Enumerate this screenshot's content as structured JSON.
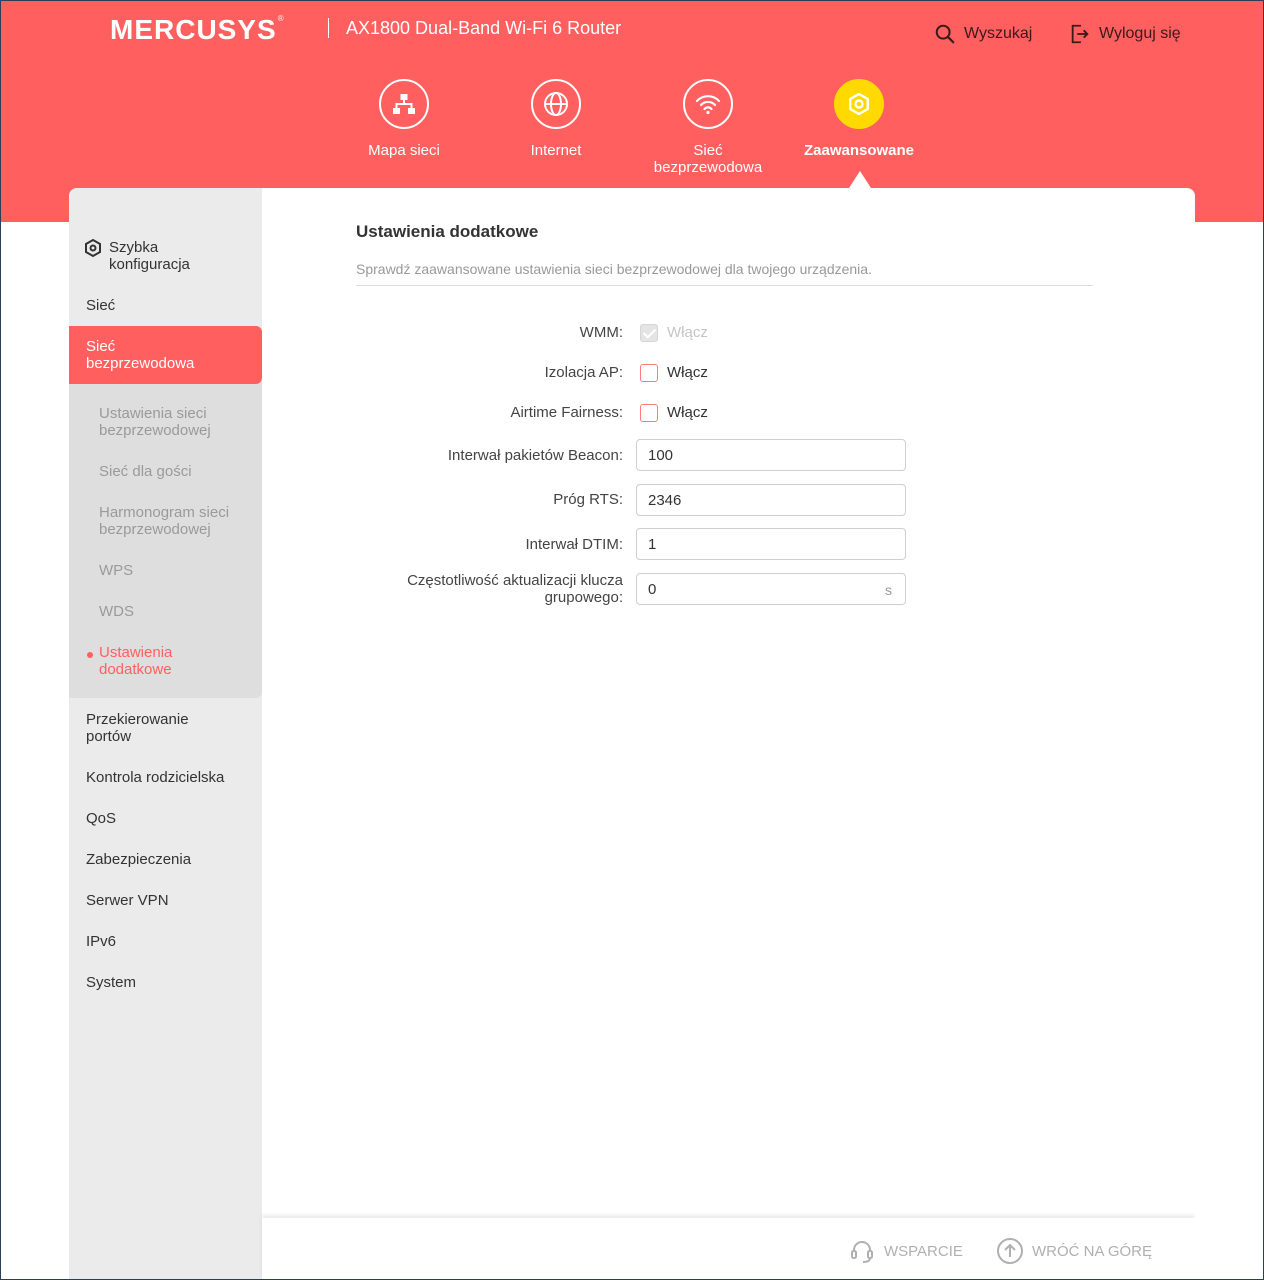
{
  "header": {
    "brand": "MERCUSYS",
    "brand_mark": "®",
    "model": "AX1800 Dual-Band Wi-Fi 6 Router",
    "search_label": "Wyszukaj",
    "logout_label": "Wyloguj się"
  },
  "nav": {
    "items": [
      {
        "label": "Mapa sieci",
        "icon": "network-map-icon"
      },
      {
        "label": "Internet",
        "icon": "globe-icon"
      },
      {
        "label": "Sieć bezprzewodowa",
        "icon": "wifi-icon"
      },
      {
        "label": "Zaawansowane",
        "icon": "gear-icon",
        "active": true
      }
    ]
  },
  "sidebar": {
    "quick_setup": "Szybka konfiguracja",
    "network": "Sieć",
    "wireless": "Sieć bezprzewodowa",
    "sub": {
      "wireless_settings": "Ustawienia sieci bezprzewodowej",
      "guest": "Sieć dla gości",
      "schedule": "Harmonogram sieci bezprzewodowej",
      "wps": "WPS",
      "wds": "WDS",
      "advanced": "Ustawienia dodatkowe"
    },
    "port_forwarding": "Przekierowanie portów",
    "parental": "Kontrola rodzicielska",
    "qos": "QoS",
    "security": "Zabezpieczenia",
    "vpn": "Serwer VPN",
    "ipv6": "IPv6",
    "system": "System"
  },
  "main": {
    "title": "Ustawienia dodatkowe",
    "description": "Sprawdź zaawansowane ustawienia sieci bezprzewodowej dla twojego urządzenia.",
    "wmm": {
      "label": "WMM:",
      "option": "Włącz",
      "checked": true,
      "disabled": true
    },
    "ap_isolation": {
      "label": "Izolacja AP:",
      "option": "Włącz",
      "checked": false
    },
    "airtime": {
      "label": "Airtime Fairness:",
      "option": "Włącz",
      "checked": false
    },
    "beacon": {
      "label": "Interwał pakietów Beacon:",
      "value": "100"
    },
    "rts": {
      "label": "Próg RTS:",
      "value": "2346"
    },
    "dtim": {
      "label": "Interwał DTIM:",
      "value": "1"
    },
    "group_key": {
      "label": "Częstotliwość aktualizacji klucza grupowego:",
      "value": "0",
      "unit": "s"
    }
  },
  "footer": {
    "support": "WSPARCIE",
    "back_to_top": "WRÓĆ NA GÓRĘ"
  },
  "colors": {
    "accent": "#ff5f5f",
    "active_nav": "#ffd900"
  }
}
